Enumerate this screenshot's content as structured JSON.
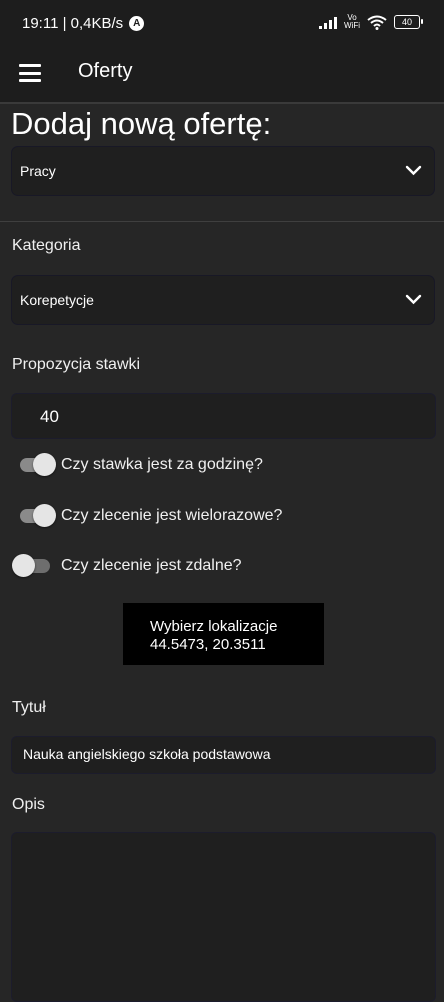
{
  "status_bar": {
    "time_speed": "19:11 | 0,4KB/s",
    "notif_icon": "A",
    "vowifi_top": "Vo",
    "vowifi_bottom": "WiFi",
    "battery": "40"
  },
  "app_bar": {
    "title": "Oferty",
    "menu_icon": "hamburger-menu-icon"
  },
  "page": {
    "heading": "Dodaj nową ofertę:"
  },
  "form": {
    "offer_type": {
      "value": "Pracy"
    },
    "category": {
      "label": "Kategoria",
      "value": "Korepetycje"
    },
    "rate": {
      "label": "Propozycja stawki",
      "value": "40"
    },
    "toggles": [
      {
        "label": "Czy stawka jest za godzinę?",
        "on": true
      },
      {
        "label": "Czy zlecenie jest wielorazowe?",
        "on": true
      },
      {
        "label": "Czy zlecenie jest zdalne?",
        "on": false
      }
    ],
    "location_button": {
      "line1": "Wybierz lokalizacje",
      "line2": "44.5473, 20.3511"
    },
    "title": {
      "label": "Tytuł",
      "value": "Nauka angielskiego szkoła podstawowa"
    },
    "description": {
      "label": "Opis",
      "value": ""
    }
  },
  "colors": {
    "background": "#262626",
    "app_bar": "#1d1d1d",
    "field": "#1f1f1f",
    "button": "#000000"
  }
}
